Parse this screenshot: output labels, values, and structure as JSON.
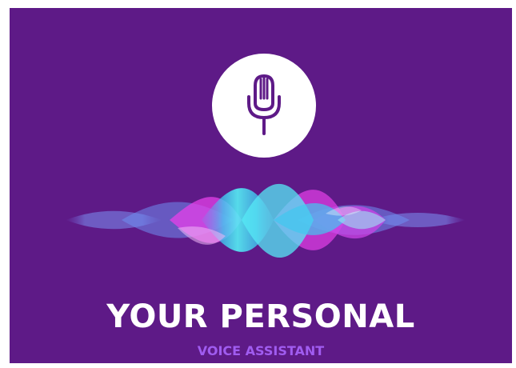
{
  "poster": {
    "title": "YOUR PERSONAL",
    "subtitle": "VOICE ASSISTANT",
    "icon": "microphone-icon"
  },
  "colors": {
    "background": "#5e1a87",
    "circle": "#ffffff",
    "icon": "#5e1a87",
    "title": "#ffffff",
    "subtitle": "#a05cf0",
    "wave_cyan": "#33e0f0",
    "wave_magenta": "#e640e8",
    "wave_blue": "#6f8ef0"
  }
}
